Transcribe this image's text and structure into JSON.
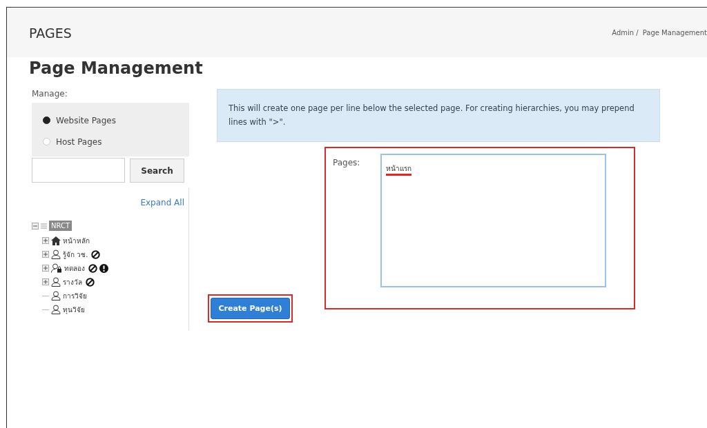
{
  "header": {
    "title": "PAGES",
    "breadcrumb": [
      {
        "label": "Admin /"
      },
      {
        "label": "Page Management"
      }
    ]
  },
  "heading": "Page Management",
  "manage": {
    "label": "Manage:",
    "options": [
      {
        "label": "Website Pages",
        "selected": true
      },
      {
        "label": "Host Pages",
        "selected": false
      }
    ]
  },
  "search": {
    "button": "Search"
  },
  "tree": {
    "expand_all": "Expand All",
    "root": {
      "label": "NRCT",
      "selected": true,
      "children": [
        {
          "label": "หน้าหลัก",
          "kind": "home",
          "expandable": true,
          "disabled": false,
          "warning": false
        },
        {
          "label": "รู้จัก วช.",
          "kind": "user",
          "expandable": true,
          "disabled": true,
          "warning": false
        },
        {
          "label": "ทดลอง",
          "kind": "locked",
          "expandable": true,
          "disabled": true,
          "warning": true
        },
        {
          "label": "รางวัล",
          "kind": "user",
          "expandable": true,
          "disabled": true,
          "warning": false
        },
        {
          "label": "การวิจัย",
          "kind": "user",
          "expandable": false,
          "disabled": false,
          "warning": false
        },
        {
          "label": "ทุนวิจัย",
          "kind": "user",
          "expandable": false,
          "disabled": false,
          "warning": false
        }
      ]
    }
  },
  "info": "This will create one page per line below the selected page. For creating hierarchies, you may prepend lines with \">\".",
  "form": {
    "label": "Pages:",
    "value": "หน้าแรก",
    "value_underlined": true,
    "highlighted": true
  },
  "create_button": {
    "label": "Create Page(s)",
    "highlighted": true
  }
}
